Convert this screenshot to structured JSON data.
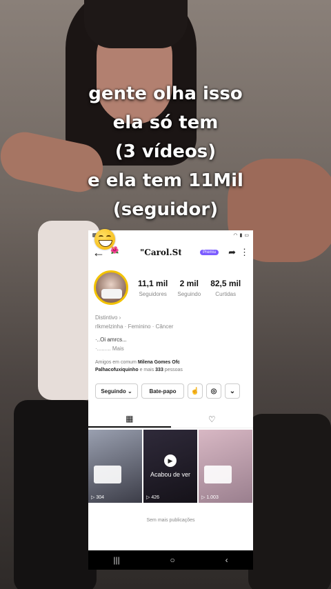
{
  "caption": {
    "lines": [
      "gente olha isso",
      "ela só tem",
      "(3 vídeos)",
      "e ela tem 11Mil",
      "(seguidor)"
    ]
  },
  "profile": {
    "username": "\"Carol.St",
    "premium_badge": "Premiu",
    "stats": [
      {
        "value": "11,1 mil",
        "label": "Seguidores"
      },
      {
        "value": "2 mil",
        "label": "Seguindo"
      },
      {
        "value": "82,5 mil",
        "label": "Curtidas"
      }
    ],
    "bio_badge": "Distintivo ›",
    "bio_meta": "rlkmelzinha · Feminino · Câncer",
    "bio_line1": "·..Oi amrcs...",
    "bio_line2": "·.........  Mais",
    "mutuals_prefix": "Amigos em comum",
    "mutual1": "Milena Gomes Ofc",
    "mutual2": "Palhacofuxiquinho",
    "mutuals_suffix_a": "e mais",
    "mutuals_count": "333",
    "mutuals_suffix_b": "pessoas",
    "follow_btn": "Seguindo ⌄",
    "chat_btn": "Bate-papo"
  },
  "posts": [
    {
      "views": "▷ 304"
    },
    {
      "views": "▷ 426",
      "overlay": "Acabou de ver"
    },
    {
      "views": "▷ 1.003"
    }
  ],
  "no_more_posts": "Sem mais publicações"
}
